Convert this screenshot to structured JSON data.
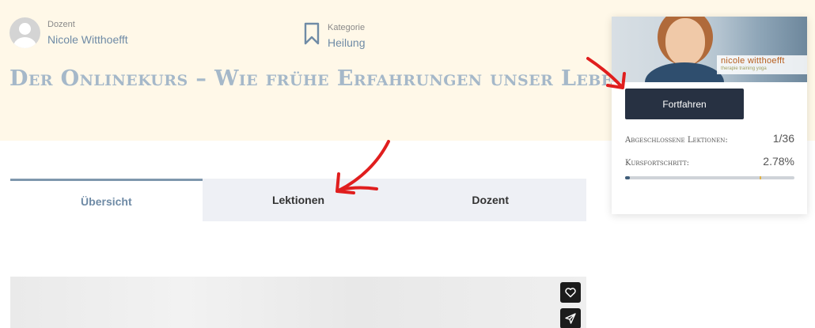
{
  "header": {
    "instructor_label": "Dozent",
    "instructor_name": "Nicole Witthoefft",
    "category_label": "Kategorie",
    "category_name": "Heilung",
    "course_title": "Der Onlinekurs – Wie frühe Erfahrungen unser Leben prägen"
  },
  "tabs": [
    {
      "label": "Übersicht",
      "active": true
    },
    {
      "label": "Lektionen",
      "active": false
    },
    {
      "label": "Dozent",
      "active": false
    }
  ],
  "card": {
    "brand_name": "nicole witthoefft",
    "brand_subtitle": "therapie training yoga",
    "continue_label": "Fortfahren",
    "completed_lessons_label": "Abgeschlossene Lektionen:",
    "completed_lessons_value": "1/36",
    "progress_label": "Kursfortschritt:",
    "progress_value": "2.78%",
    "progress_fraction": 0.0278
  },
  "colors": {
    "hero_bg": "#fff8e8",
    "accent": "#6f8ba6",
    "button_dark": "#273142",
    "annotation_red": "#e01e1e"
  },
  "icons": {
    "category": "bookmark-icon",
    "like": "heart-icon",
    "share": "send-icon"
  }
}
